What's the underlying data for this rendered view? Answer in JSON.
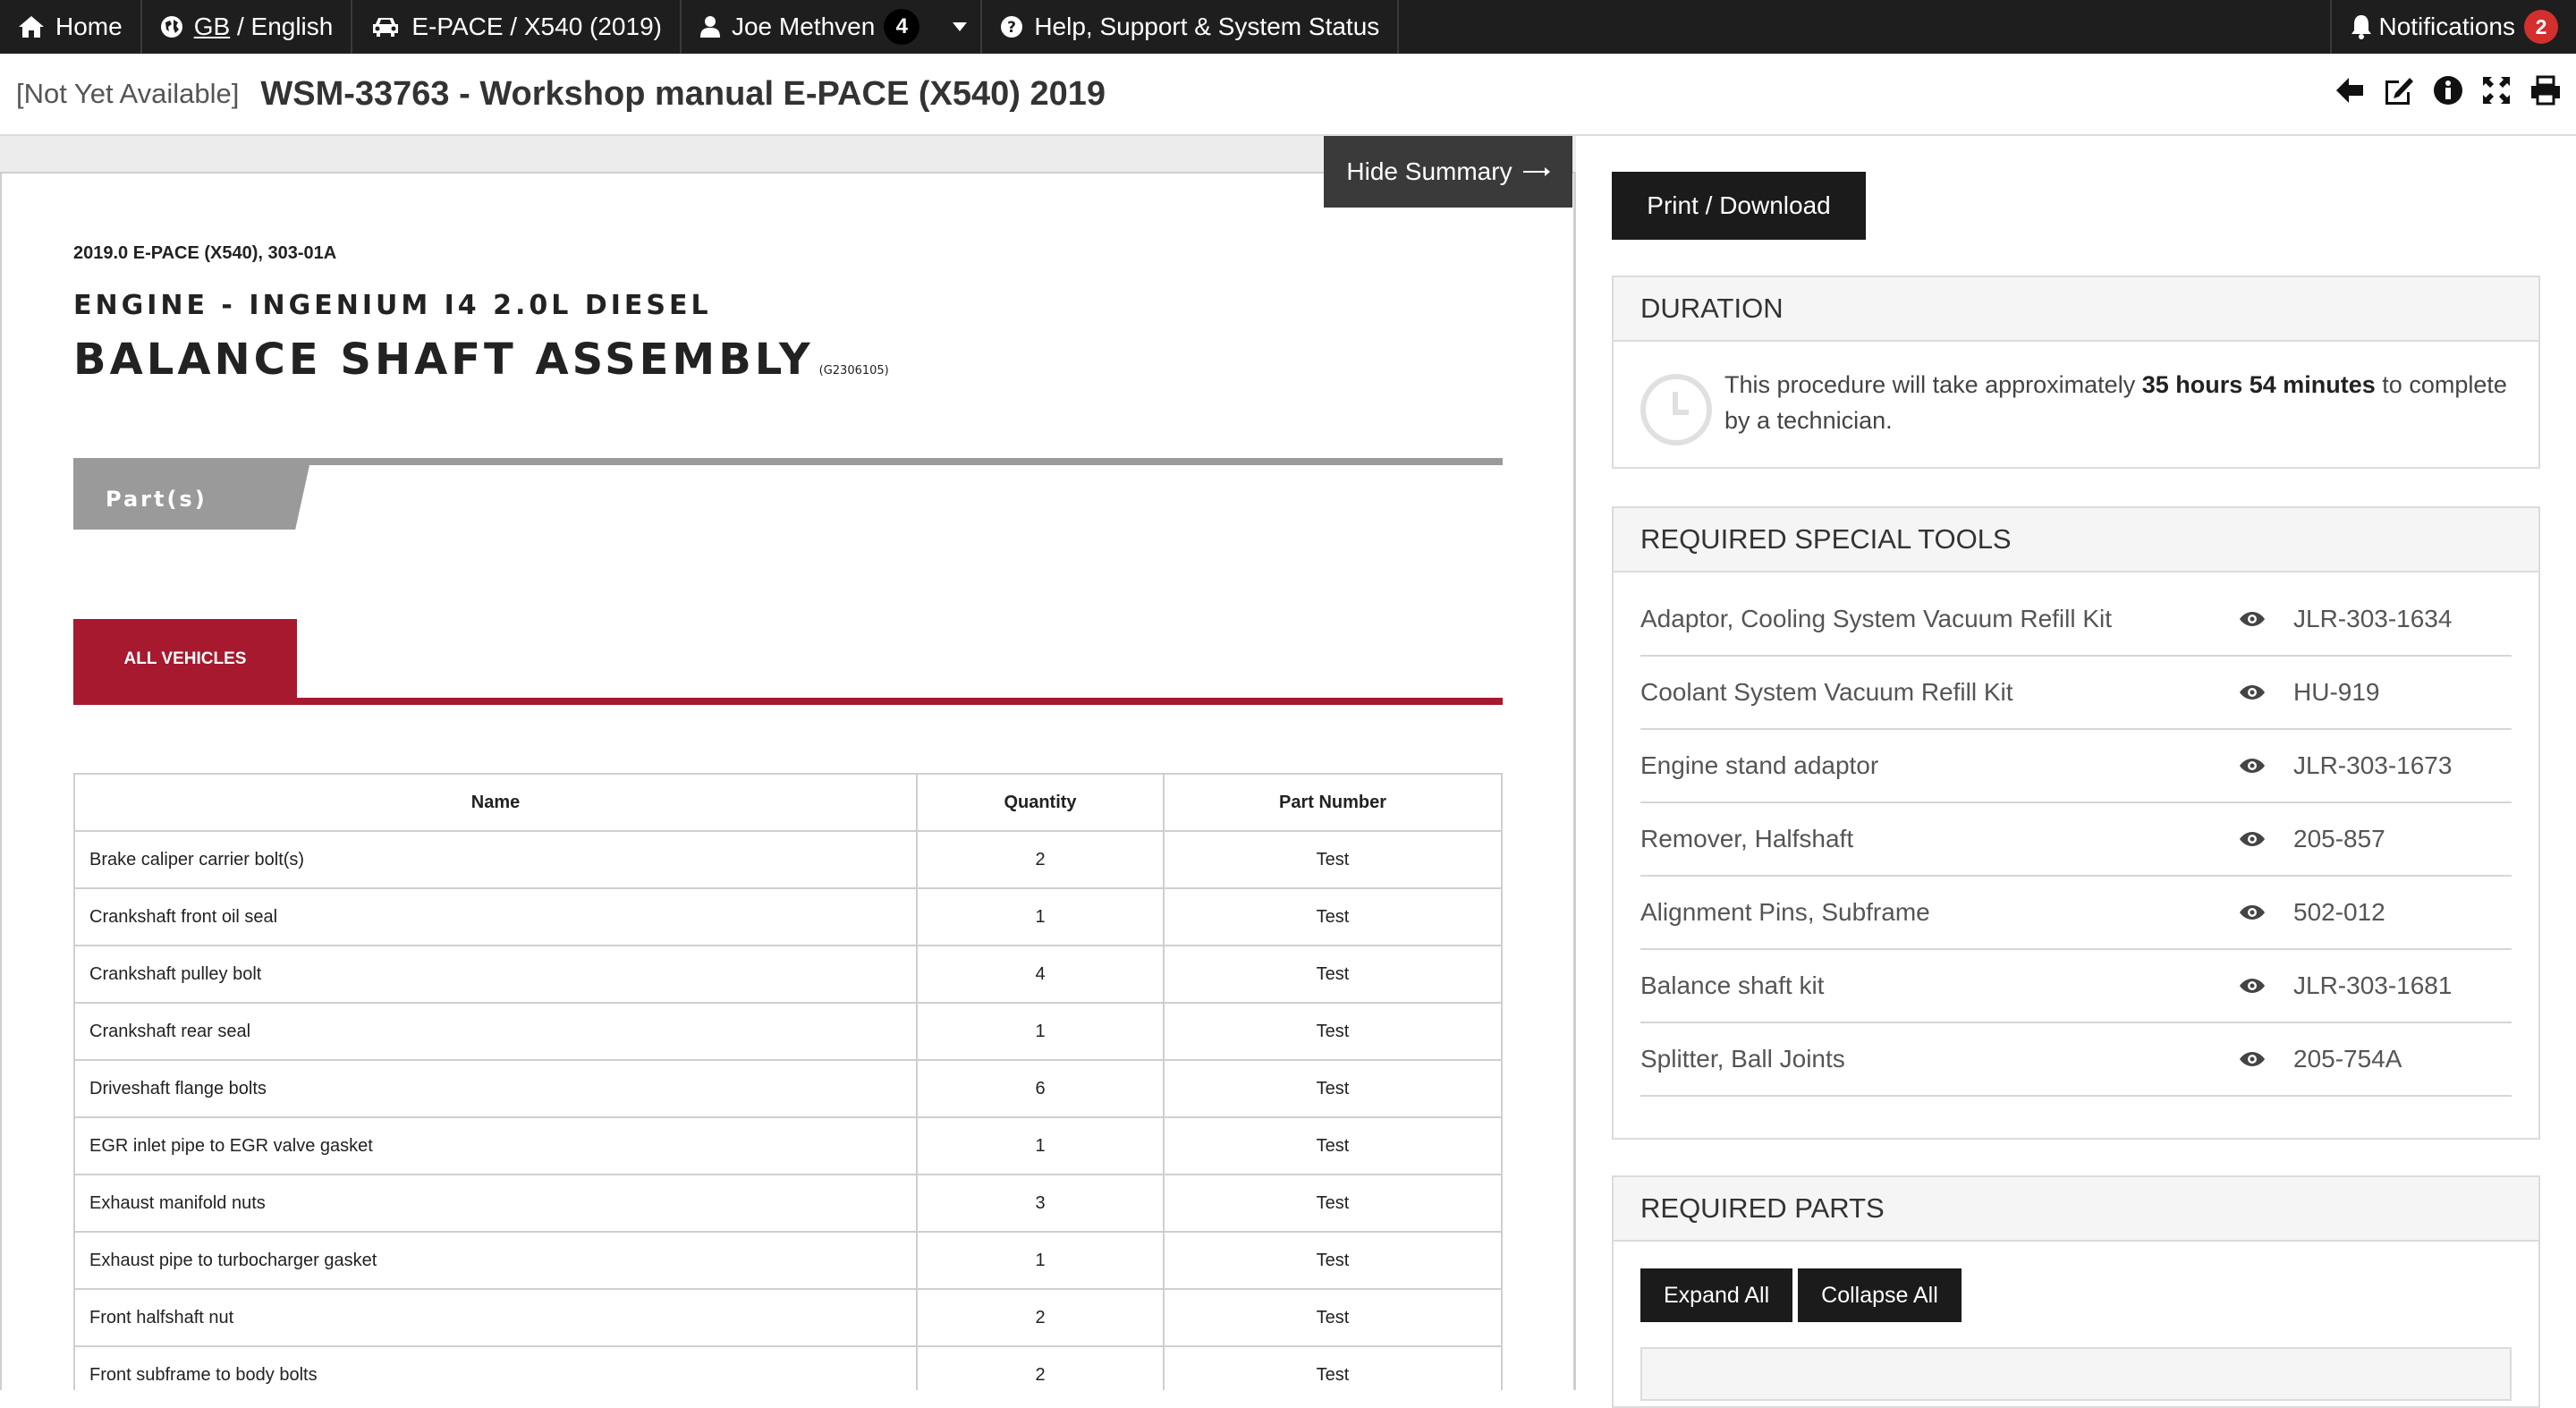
{
  "nav": {
    "home": "Home",
    "region": "GB",
    "language": "/ English",
    "vehicle": "E-PACE / X540 (2019)",
    "user": "Joe Methven",
    "user_count": "4",
    "help": "Help, Support & System Status",
    "notifications": "Notifications",
    "notifications_count": "2"
  },
  "header": {
    "availability": "[Not Yet Available]",
    "title": "WSM-33763 - Workshop manual E-PACE (X540) 2019"
  },
  "document": {
    "hide_summary": "Hide Summary",
    "meta": "2019.0 E-PACE (X540), 303-01A",
    "subtitle": "Engine - Ingenium I4 2.0L Diesel",
    "heading": "Balance Shaft Assembly",
    "code": "(G2306105)",
    "parts_tab": "Part(s)",
    "vehicles_tab": "ALL VEHICLES",
    "table": {
      "headers": [
        "Name",
        "Quantity",
        "Part Number"
      ],
      "rows": [
        {
          "name": "Brake caliper carrier bolt(s)",
          "qty": "2",
          "part": "Test"
        },
        {
          "name": "Crankshaft front oil seal",
          "qty": "1",
          "part": "Test"
        },
        {
          "name": "Crankshaft pulley bolt",
          "qty": "4",
          "part": "Test"
        },
        {
          "name": "Crankshaft rear seal",
          "qty": "1",
          "part": "Test"
        },
        {
          "name": "Driveshaft flange bolts",
          "qty": "6",
          "part": "Test"
        },
        {
          "name": "EGR inlet pipe to EGR valve gasket",
          "qty": "1",
          "part": "Test"
        },
        {
          "name": "Exhaust manifold nuts",
          "qty": "3",
          "part": "Test"
        },
        {
          "name": "Exhaust pipe to turbocharger gasket",
          "qty": "1",
          "part": "Test"
        },
        {
          "name": "Front halfshaft nut",
          "qty": "2",
          "part": "Test"
        },
        {
          "name": "Front subframe to body bolts",
          "qty": "2",
          "part": "Test"
        }
      ]
    }
  },
  "summary": {
    "print_download": "Print / Download",
    "duration": {
      "title": "DURATION",
      "text_before": "This procedure will take approximately ",
      "time": "35 hours 54 minutes",
      "text_after": " to complete by a technician."
    },
    "tools": {
      "title": "REQUIRED SPECIAL TOOLS",
      "items": [
        {
          "name": "Adaptor, Cooling System Vacuum Refill Kit",
          "code": "JLR-303-1634"
        },
        {
          "name": "Coolant System Vacuum Refill Kit",
          "code": "HU-919"
        },
        {
          "name": "Engine stand adaptor",
          "code": "JLR-303-1673"
        },
        {
          "name": "Remover, Halfshaft",
          "code": "205-857"
        },
        {
          "name": "Alignment Pins, Subframe",
          "code": "502-012"
        },
        {
          "name": "Balance shaft kit",
          "code": "JLR-303-1681"
        },
        {
          "name": "Splitter, Ball Joints",
          "code": "205-754A"
        }
      ]
    },
    "parts": {
      "title": "REQUIRED PARTS",
      "expand_all": "Expand All",
      "collapse_all": "Collapse All"
    }
  },
  "icons": {
    "home": "home-icon",
    "globe": "globe-icon",
    "car": "car-icon",
    "user": "user-icon",
    "help": "question-circle-icon",
    "bell": "bell-icon",
    "back": "arrow-left-icon",
    "edit": "edit-icon",
    "info": "info-icon",
    "fullscreen": "expand-icon",
    "print": "print-icon",
    "eye": "eye-icon",
    "clock": "clock-icon"
  },
  "colors": {
    "nav_bg": "#1e1e1e",
    "accent_red": "#a6192e",
    "badge_red": "#d32f2f",
    "button_dark": "#1b1b1b"
  }
}
